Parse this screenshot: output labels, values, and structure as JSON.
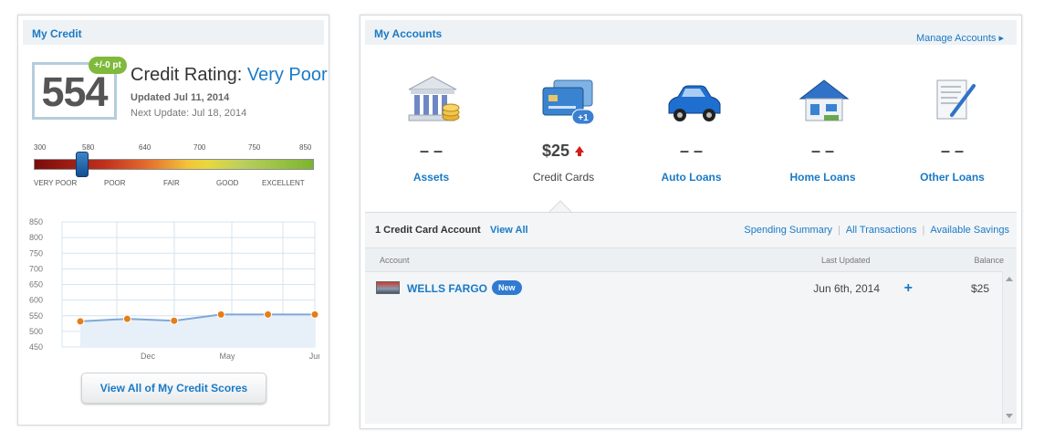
{
  "my_credit": {
    "title": "My Credit",
    "score": "554",
    "score_change": "+/-0 pt",
    "rating_label": "Credit Rating:",
    "rating_value": "Very Poor",
    "updated": "Updated Jul 11, 2014",
    "next_update": "Next Update: Jul 18, 2014",
    "scale_ticks": [
      "300",
      "580",
      "640",
      "700",
      "750",
      "850"
    ],
    "scale_categories": [
      "VERY POOR",
      "POOR",
      "FAIR",
      "GOOD",
      "EXCELLENT"
    ],
    "view_all_button": "View All of My Credit Scores",
    "colors": {
      "accent": "#1a7ac6",
      "point": "#e77d16",
      "line": "#7ea8d8"
    }
  },
  "chart_data": {
    "type": "line",
    "title": "",
    "xlabel": "",
    "ylabel": "",
    "ylim": [
      450,
      850
    ],
    "yticks": [
      "850",
      "800",
      "750",
      "700",
      "650",
      "600",
      "550",
      "500",
      "450"
    ],
    "xticks": [
      "Dec",
      "May",
      "Jun"
    ],
    "series": [
      {
        "values": [
          532,
          540,
          534,
          554,
          554,
          554
        ]
      }
    ],
    "grid": true
  },
  "my_accounts": {
    "title": "My Accounts",
    "manage_link": "Manage Accounts ▸",
    "types": [
      {
        "label": "Assets",
        "amount": "– –",
        "icon": "bank-icon"
      },
      {
        "label": "Credit Cards",
        "amount": "$25",
        "icon": "credit-card-icon",
        "badge": "+1"
      },
      {
        "label": "Auto Loans",
        "amount": "– –",
        "icon": "car-icon"
      },
      {
        "label": "Home Loans",
        "amount": "– –",
        "icon": "house-icon"
      },
      {
        "label": "Other Loans",
        "amount": "– –",
        "icon": "document-icon"
      }
    ],
    "credit_card_section": {
      "count_label": "1 Credit Card Account",
      "view_all": "View All",
      "links": [
        "Spending Summary",
        "All Transactions",
        "Available Savings"
      ],
      "columns": [
        "Account",
        "Last Updated",
        "Balance"
      ],
      "rows": [
        {
          "name": "WELLS FARGO",
          "badge": "New",
          "last_updated": "Jun 6th, 2014",
          "balance": "$25"
        }
      ]
    }
  }
}
